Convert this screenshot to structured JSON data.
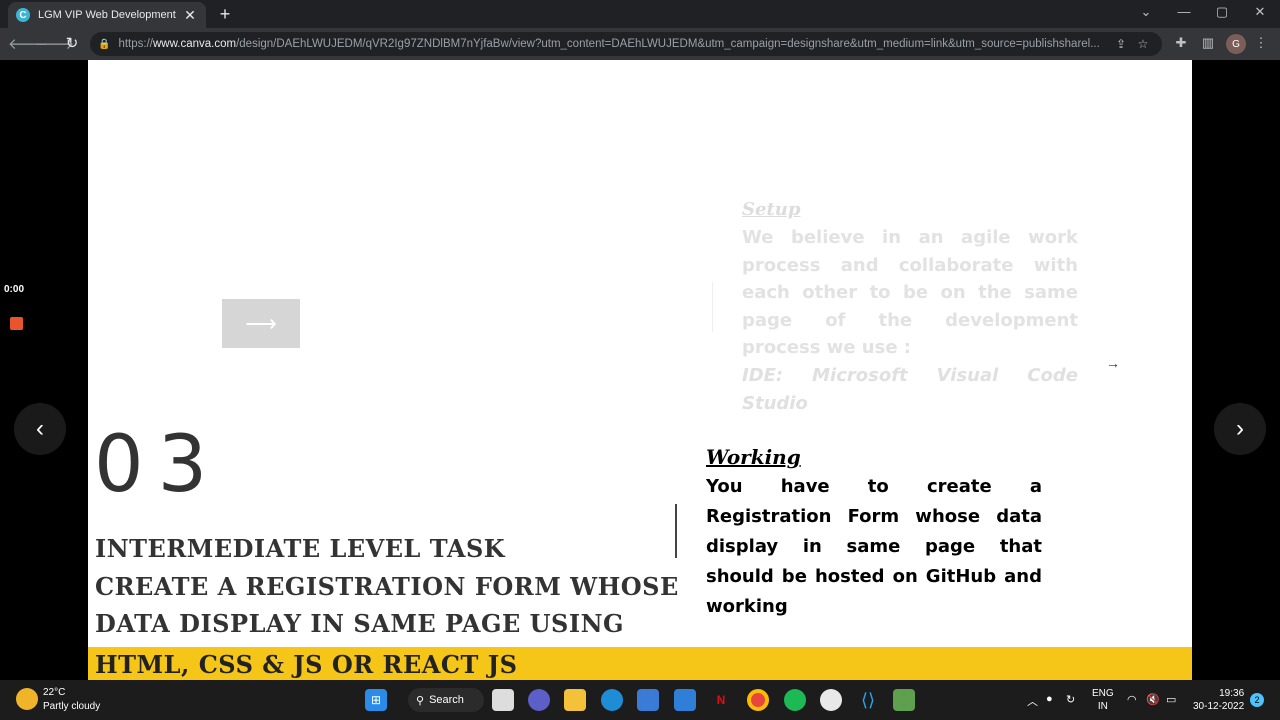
{
  "browser": {
    "tab_title": "LGM VIP Web Development",
    "tab_favicon": "C",
    "new_tab": "+",
    "close_tab": "✕",
    "url_prefix": "https://",
    "url_domain": "www.canva.com",
    "url_rest": "/design/DAEhLWUJEDM/qVR2Ig97ZNDlBM7nYjfaBw/view?utm_content=DAEhLWUJEDM&utm_campaign=designshare&utm_medium=link&utm_source=publishsharel...",
    "avatar_initial": "G",
    "icons": {
      "back": "🡐",
      "forward": "🡒",
      "reload": "↻",
      "lock": "🔒",
      "share": "⇪",
      "star": "☆",
      "extensions": "✚",
      "sidepanel": "▥",
      "menu": "⋮",
      "chevron": "⌄",
      "minimize": "—",
      "maximize": "▢",
      "close": "✕"
    }
  },
  "presenter": {
    "timer": "0:00",
    "prev": "‹",
    "next": "›"
  },
  "slide": {
    "ghost_arrow": "⟶",
    "setup_title": "Setup",
    "setup_body": "We believe in an agile work process and collaborate with each other to be on the same page of the development process we use :",
    "setup_ide": "IDE: Microsoft Visual Code Studio",
    "small_arrow": "→",
    "number": "03",
    "task_lines": [
      "INTERMEDIATE LEVEL TASK",
      "CREATE A REGISTRATION FORM WHOSE",
      "DATA DISPLAY IN SAME PAGE  USING"
    ],
    "task_last_line": "HTML, CSS & JS OR REACT JS",
    "working_title": "Working",
    "working_body": "You have to create a Registration Form whose data display in same page that should be hosted on GitHub and working"
  },
  "taskbar": {
    "temp": "22°C",
    "weather": "Partly cloudy",
    "search_label": "Search",
    "search_icon": "⚲",
    "lang_1": "ENG",
    "lang_2": "IN",
    "time": "19:36",
    "date": "30-12-2022",
    "notifications": "2",
    "tray_chevron": "︿",
    "wifi": "◠",
    "volume": "🔇",
    "battery": "▭"
  }
}
